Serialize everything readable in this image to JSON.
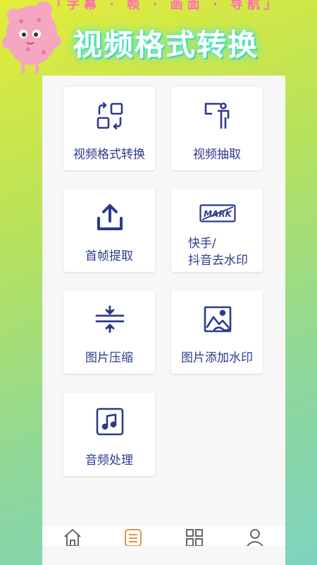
{
  "header": {
    "banner_text": "「字幕 · 帧 · 画面 · 导航」",
    "title": "视频格式转换"
  },
  "features": [
    {
      "label": "视频格式转换",
      "icon": "format-convert-icon"
    },
    {
      "label": "视频抽取",
      "icon": "video-extract-icon"
    },
    {
      "label": "首帧提取",
      "icon": "upload-icon"
    },
    {
      "label_line1": "快手/",
      "label_line2": "抖音去水印",
      "icon": "watermark-remove-icon"
    },
    {
      "label": "图片压缩",
      "icon": "compress-icon"
    },
    {
      "label": "图片添加水印",
      "icon": "image-watermark-icon"
    },
    {
      "label": "音频处理",
      "icon": "music-note-icon"
    }
  ],
  "watermark_badge_text": "MARK",
  "tabs": [
    {
      "name": "home",
      "icon": "home-icon",
      "active": false
    },
    {
      "name": "tools",
      "icon": "list-icon",
      "active": true
    },
    {
      "name": "apps",
      "icon": "grid-icon",
      "active": false
    },
    {
      "name": "profile",
      "icon": "user-icon",
      "active": false
    }
  ],
  "colors": {
    "accent": "#2d3a8c",
    "active_tab": "#e0863a",
    "title_glow": "#50e6c6",
    "mascot": "#f5a6c0"
  }
}
